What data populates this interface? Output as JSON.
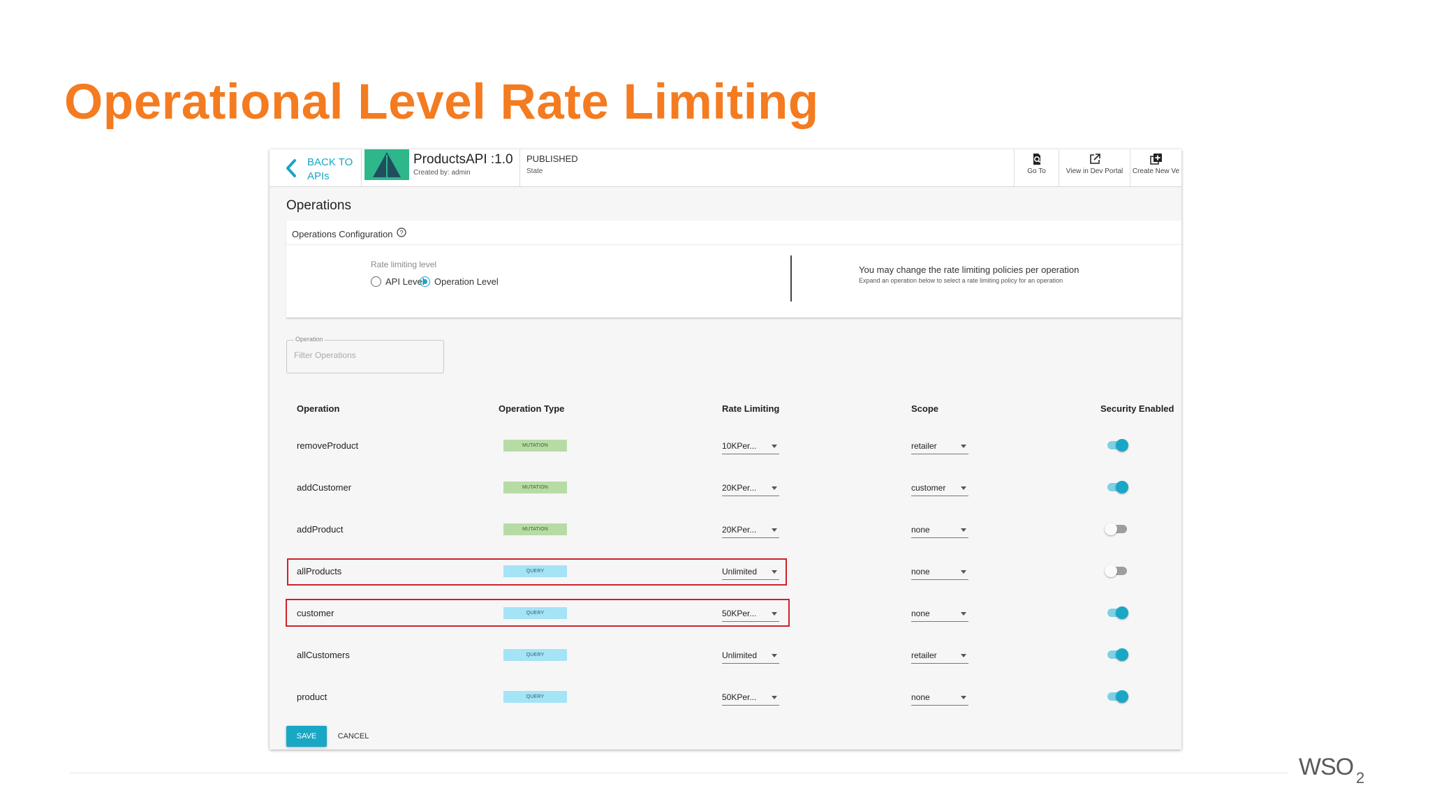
{
  "slide": {
    "title": "Operational Level Rate Limiting",
    "logo": "WSO2"
  },
  "header": {
    "back_label": "BACK TO APIs",
    "api_name": "ProductsAPI :1.0",
    "created_by": "Created by: admin",
    "state_value": "PUBLISHED",
    "state_label": "State",
    "buttons": [
      {
        "label": "Go To",
        "icon": "search-doc-icon"
      },
      {
        "label": "View in Dev Portal",
        "icon": "external-link-icon"
      },
      {
        "label": "Create New Ve",
        "icon": "add-box-icon"
      }
    ]
  },
  "section_title": "Operations",
  "config": {
    "title": "Operations Configuration",
    "rate_limiting_label": "Rate limiting level",
    "options": [
      {
        "label": "API Level",
        "selected": false
      },
      {
        "label": "Operation Level",
        "selected": true
      }
    ],
    "message": "You may change the rate limiting policies per operation",
    "sub_message": "Expand an operation below to select a rate limiting policy for an operation"
  },
  "filter": {
    "label": "Operation",
    "placeholder": "Filter Operations"
  },
  "columns": [
    "Operation",
    "Operation Type",
    "Rate Limiting",
    "Scope",
    "Security Enabled"
  ],
  "operations": [
    {
      "name": "removeProduct",
      "type": "MUTATION",
      "rate": "10KPer...",
      "scope": "retailer",
      "security": true,
      "highlighted": false
    },
    {
      "name": "addCustomer",
      "type": "MUTATION",
      "rate": "20KPer...",
      "scope": "customer",
      "security": true,
      "highlighted": false
    },
    {
      "name": "addProduct",
      "type": "MUTATION",
      "rate": "20KPer...",
      "scope": "none",
      "security": false,
      "highlighted": false
    },
    {
      "name": "allProducts",
      "type": "QUERY",
      "rate": "Unlimited",
      "scope": "none",
      "security": false,
      "highlighted": true
    },
    {
      "name": "customer",
      "type": "QUERY",
      "rate": "50KPer...",
      "scope": "none",
      "security": true,
      "highlighted": true
    },
    {
      "name": "allCustomers",
      "type": "QUERY",
      "rate": "Unlimited",
      "scope": "retailer",
      "security": true,
      "highlighted": false
    },
    {
      "name": "product",
      "type": "QUERY",
      "rate": "50KPer...",
      "scope": "none",
      "security": true,
      "highlighted": false
    }
  ],
  "actions": {
    "save": "SAVE",
    "cancel": "CANCEL"
  },
  "colors": {
    "title_orange": "#f47b20",
    "accent_teal": "#19a7c6",
    "highlight_red": "#d0202a",
    "mutation_badge": "#b6dca4",
    "query_badge": "#a5e3f6"
  }
}
